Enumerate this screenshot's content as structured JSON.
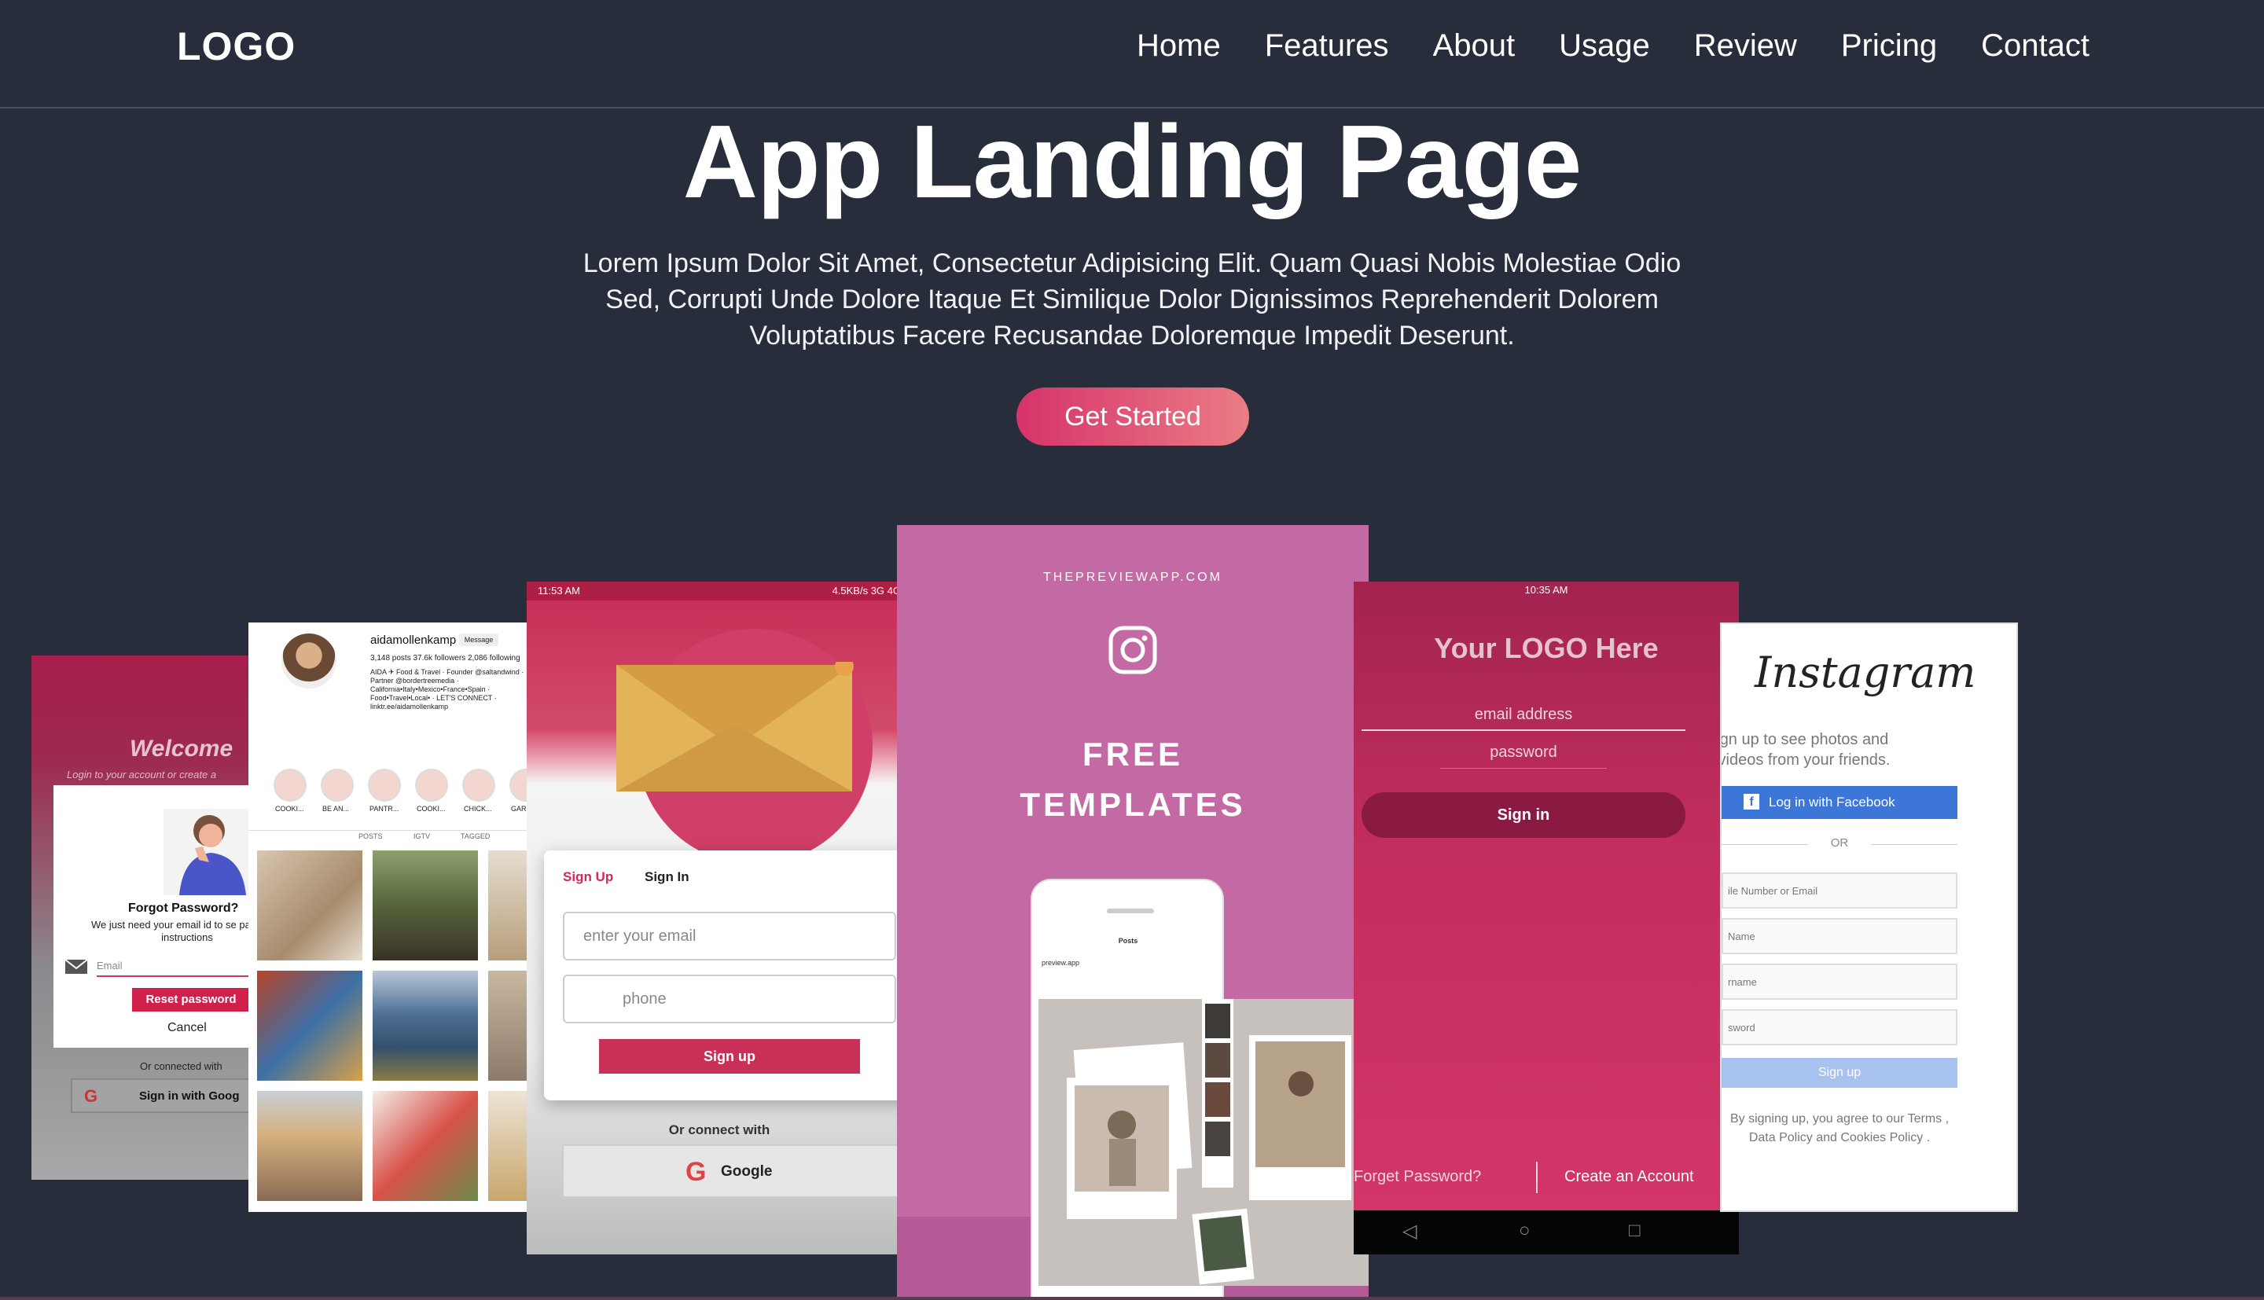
{
  "nav": {
    "logo": "LOGO",
    "items": [
      "Home",
      "Features",
      "About",
      "Usage",
      "Review",
      "Pricing",
      "Contact"
    ]
  },
  "hero": {
    "title": "App Landing Page",
    "description": "Lorem Ipsum Dolor Sit Amet, Consectetur Adipisicing Elit. Quam Quasi Nobis Molestiae Odio Sed, Corrupti Unde Dolore Itaque Et Similique Dolor Dignissimos Reprehenderit Dolorem Voluptatibus Facere Recusandae Doloremque Impedit Deserunt.",
    "cta": "Get Started"
  },
  "colors": {
    "background": "#282d3b",
    "cta_start": "#d7336a",
    "cta_end": "#ea7d85"
  },
  "screens": {
    "forgot": {
      "welcome": "Welcome",
      "subtitle": "Login to your account or create a",
      "title": "Forgot Password?",
      "desc": "We just need your email id to se password instructions",
      "email_placeholder": "Email",
      "reset": "Reset password",
      "cancel": "Cancel",
      "or": "Or connected with",
      "google": "Sign in with Goog"
    },
    "profile": {
      "username": "aidamollenkamp",
      "message": "Message",
      "stats": "3,148 posts   37.6k followers   2,086 following",
      "bio": "AIDA ✈ Food & Travel · Founder @saltandwind · Partner @bordertreemedia · California•Italy•Mexico•France•Spain · Food•Travel•Local• · LET'S CONNECT · linktr.ee/aidamollenkamp",
      "highlights": [
        "COOKI...",
        "BE AN...",
        "PANTR...",
        "COOKI...",
        "CHICK...",
        "GAR"
      ],
      "tabs": [
        "POSTS",
        "IGTV",
        "TAGGED"
      ]
    },
    "signup": {
      "status_left": "11:53 AM",
      "status_right": "4.5KB/s  3G  4G",
      "tab_signup": "Sign Up",
      "tab_signin": "Sign In",
      "email_placeholder": "enter your email",
      "phone_placeholder": "phone",
      "button": "Sign up",
      "or": "Or connect with",
      "google": "Google"
    },
    "preview": {
      "url": "THEPREVIEWAPP.COM",
      "line1": "FREE",
      "line2": "TEMPLATES",
      "phone_title": "Posts",
      "phone_user": "preview.app"
    },
    "login": {
      "status": "10:35 AM",
      "logo": "Your LOGO Here",
      "email": "email address",
      "password": "password",
      "button": "Sign in",
      "forgot": "Forget Password?",
      "create": "Create an Account"
    },
    "instagram": {
      "brand": "Instagram",
      "tagline": "gn up to see photos and videos from your friends.",
      "facebook": "Log in with Facebook",
      "or": "OR",
      "fields": [
        "ile Number or Email",
        "Name",
        "rname",
        "sword"
      ],
      "signup": "Sign up",
      "terms": "By signing up, you agree to our Terms , Data Policy and Cookies Policy ."
    }
  }
}
